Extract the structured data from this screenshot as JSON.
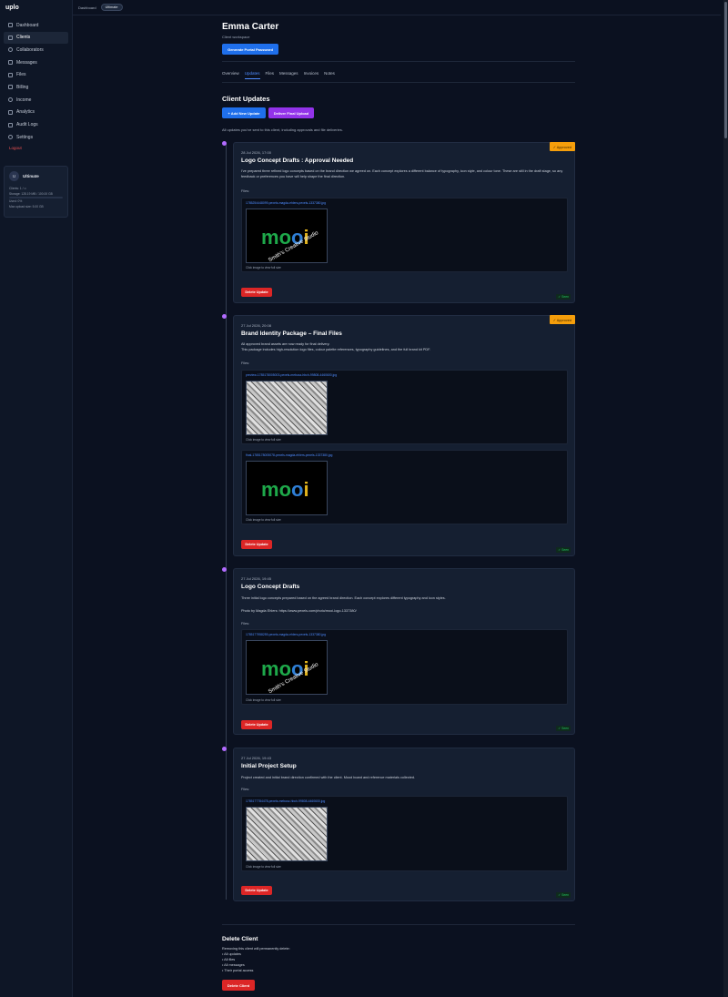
{
  "app": {
    "logo": "uplo"
  },
  "sidebar": {
    "items": [
      {
        "label": "Dashboard",
        "icon": "dashboard-icon"
      },
      {
        "label": "Clients",
        "icon": "users-icon",
        "active": true
      },
      {
        "label": "Collaborators",
        "icon": "collaborators-icon"
      },
      {
        "label": "Messages",
        "icon": "message-icon"
      },
      {
        "label": "Files",
        "icon": "folder-icon"
      },
      {
        "label": "Billing",
        "icon": "billing-icon"
      },
      {
        "label": "Income",
        "icon": "income-icon"
      },
      {
        "label": "Analytics",
        "icon": "analytics-icon"
      },
      {
        "label": "Audit Logs",
        "icon": "audit-icon"
      },
      {
        "label": "Settings",
        "icon": "gear-icon"
      }
    ],
    "logout": "Logout",
    "plan": {
      "avatar": "U",
      "name": "Ultimate",
      "clients": "Clients: 1 / ∞",
      "storage": "Storage: 128.19 MB / 100.00 GB",
      "used": "Used: 0%",
      "max_upload": "Max upload size: 5.00 GB"
    }
  },
  "topbar": {
    "crumb": "Dashboard",
    "pill": "Ultimate"
  },
  "client": {
    "name": "Emma Carter",
    "subtitle": "Client workspace",
    "portal_button": "Generate Portal Password"
  },
  "tabs": [
    "Overview",
    "Updates",
    "Files",
    "Messages",
    "Invoices",
    "Notes"
  ],
  "updates": {
    "title": "Client Updates",
    "add_button": "+ Add New Update",
    "deliver_button": "Deliver Final Upload",
    "description": "All updates you've sent to this client, including approvals and file deliveries."
  },
  "cards": [
    {
      "date": "28 Jul 2026, 17:00",
      "title": "Logo Concept Drafts : Approval Needed",
      "text": "I've prepared three refined logo concepts based on the brand direction we agreed on. Each concept explores a different balance of typography, icon style, and colour tone. These are still in the draft stage, so any feedback or preferences you have will help shape the final direction.",
      "badge": "✓ Approved",
      "files_label": "Files:",
      "files": [
        {
          "name": "1785254448099-pexels-magda-ehlers-pexels-1337380.jpg",
          "caption": "Click image to view full size",
          "image": "mooi-watermark"
        }
      ],
      "delete": "Delete Update",
      "seen": "✓ Seen"
    },
    {
      "date": "27 Jul 2026, 20:08",
      "title": "Brand Identity Package – Final Files",
      "text": "All approved brand assets are now ready for final delivery.",
      "text2": "This package includes high-resolution logo files, colour palette references, typography guidelines, and the full brand kit PDF.",
      "badge": "✓ Approved",
      "files_label": "Files:",
      "files": [
        {
          "name": "preview-1785178005003-pexels-mebusz-hbch-99808-4460600.jpg",
          "caption": "Click image to view full size",
          "image": "desk"
        },
        {
          "name": "final-1785178005078-pexels-magda-ehlers-pexels-1337380.jpg",
          "caption": "Click image to view full size",
          "image": "mooi"
        }
      ],
      "delete": "Delete Update",
      "seen": "✓ Seen"
    },
    {
      "date": "27 Jul 2026, 19:45",
      "title": "Logo Concept Drafts",
      "text": "Three initial logo concepts prepared based on the agreed brand direction. Each concept explores different typography and icon styles.",
      "text2": "Photo by Magda Ehlers: https://www.pexels.com/photo/mooi-logo-1337380/",
      "files_label": "Files:",
      "files": [
        {
          "name": "1785177958259-pexels-magda-ehlers-pexels-1337380.jpg",
          "caption": "Click image to view full size",
          "image": "mooi-watermark"
        }
      ],
      "delete": "Delete Update",
      "seen": "✓ Seen"
    },
    {
      "date": "27 Jul 2026, 19:43",
      "title": "Initial Project Setup",
      "text": "Project created and initial brand direction confirmed with the client. Mood board and reference materials collected.",
      "files_label": "Files:",
      "files": [
        {
          "name": "1785177784478-pexels-mebusz-hbch-99808-4460600.jpg",
          "caption": "Click image to view full size",
          "image": "desk"
        }
      ],
      "delete": "Delete Update",
      "seen": "✓ Seen"
    }
  ],
  "watermark": "Smith's Creative Studio",
  "logo_word": "mooi",
  "danger": {
    "title": "Delete Client",
    "intro": "Removing this client will permanently delete:",
    "items": [
      "• All updates",
      "• All files",
      "• All messages",
      "• Their portal access"
    ],
    "button": "Delete Client"
  },
  "colors": {
    "accent": "#1f6feb",
    "purple": "#9333ea",
    "danger": "#dc2626",
    "approved": "#f59e0b",
    "seen": "#22c55e"
  }
}
